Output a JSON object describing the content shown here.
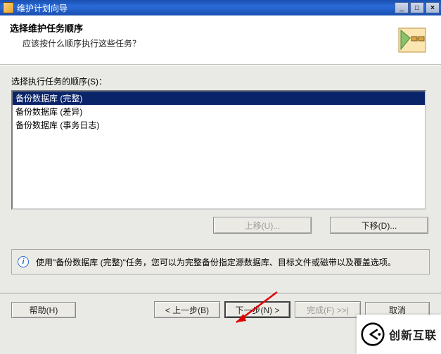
{
  "window": {
    "title": "维护计划向导",
    "min_tip": "_",
    "max_tip": "□",
    "close_tip": "×"
  },
  "header": {
    "title": "选择维护任务顺序",
    "subtitle": "应该按什么顺序执行这些任务？"
  },
  "list": {
    "label": "选择执行任务的顺序(S)：",
    "items": [
      "备份数据库 (完整)",
      "备份数据库 (差异)",
      "备份数据库 (事务日志)"
    ],
    "selected_index": 0
  },
  "move": {
    "up": "上移(U)...",
    "down": "下移(D)..."
  },
  "hint": {
    "icon": "i",
    "text": "使用\"备份数据库 (完整)\"任务，您可以为完整备份指定源数据库、目标文件或磁带以及覆盖选项。"
  },
  "footer": {
    "help": "帮助(H)",
    "back": "< 上一步(B)",
    "next": "下一步(N) >",
    "finish": "完成(F) >>|",
    "cancel": "取消"
  },
  "watermark": {
    "text": "创新互联"
  }
}
